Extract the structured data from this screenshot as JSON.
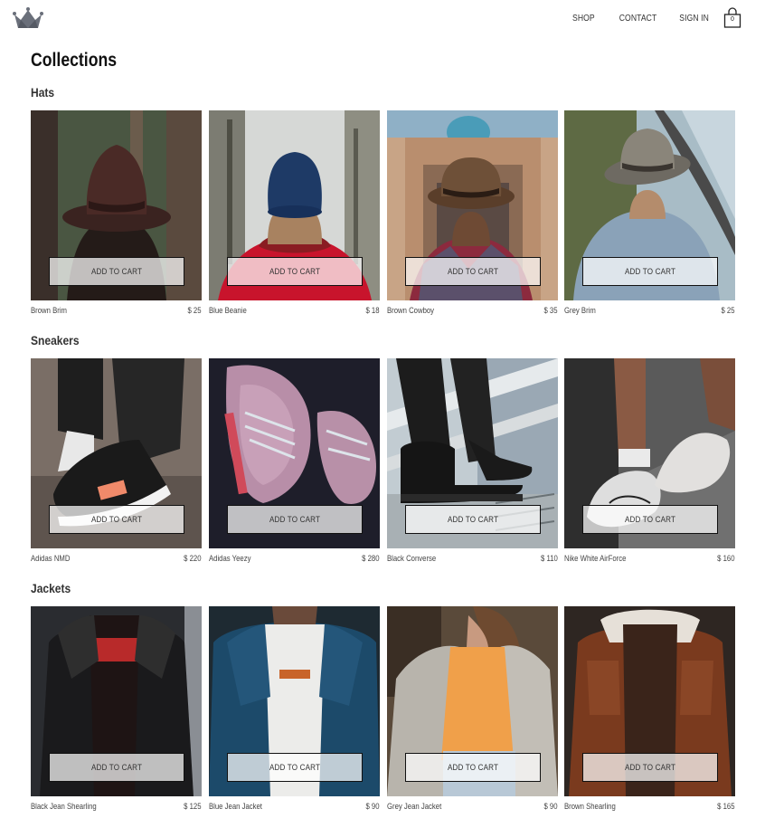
{
  "brand": {
    "logo_icon": "crown-icon"
  },
  "nav": {
    "shop": "SHOP",
    "contact": "CONTACT",
    "sign_in": "SIGN IN",
    "bag_count": "0",
    "bag_icon": "shopping-bag-icon"
  },
  "page": {
    "title": "Collections"
  },
  "add_to_cart_label": "ADD TO CART",
  "sections": [
    {
      "title": "Hats",
      "items": [
        {
          "name": "Brown Brim",
          "price": "$ 25"
        },
        {
          "name": "Blue Beanie",
          "price": "$ 18"
        },
        {
          "name": "Brown Cowboy",
          "price": "$ 35"
        },
        {
          "name": "Grey Brim",
          "price": "$ 25"
        }
      ]
    },
    {
      "title": "Sneakers",
      "items": [
        {
          "name": "Adidas NMD",
          "price": "$ 220"
        },
        {
          "name": "Adidas Yeezy",
          "price": "$ 280"
        },
        {
          "name": "Black Converse",
          "price": "$ 110"
        },
        {
          "name": "Nike White AirForce",
          "price": "$ 160"
        }
      ]
    },
    {
      "title": "Jackets",
      "items": [
        {
          "name": "Black Jean Shearling",
          "price": "$ 125"
        },
        {
          "name": "Blue Jean Jacket",
          "price": "$ 90"
        },
        {
          "name": "Grey Jean Jacket",
          "price": "$ 90"
        },
        {
          "name": "Brown Shearling",
          "price": "$ 165"
        }
      ]
    }
  ]
}
